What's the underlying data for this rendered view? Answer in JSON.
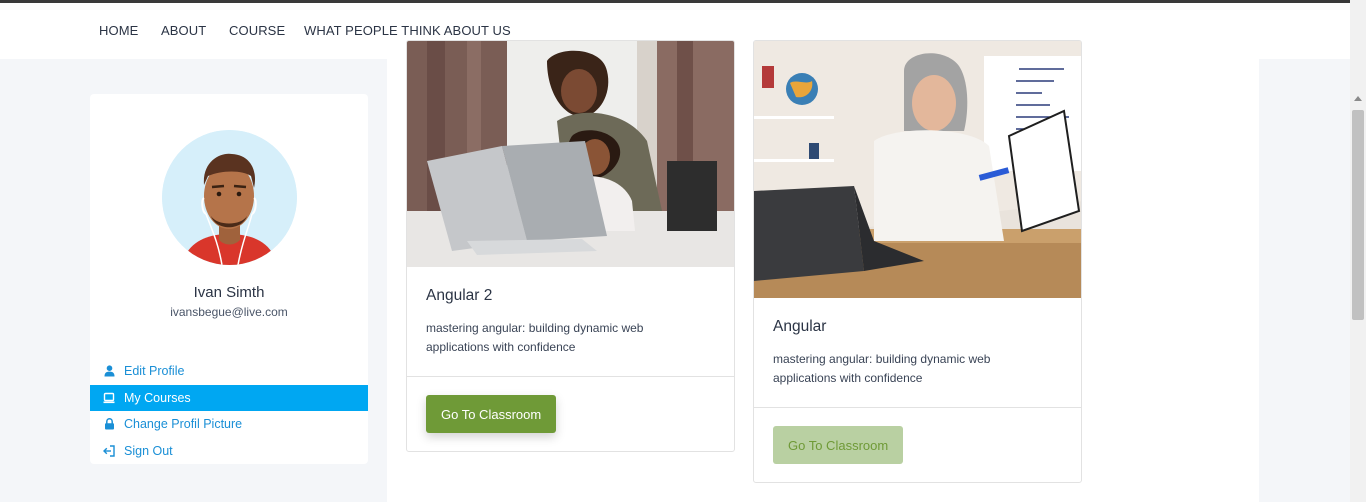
{
  "nav": {
    "items": [
      "HOME",
      "ABOUT",
      "COURSE",
      "WHAT PEOPLE THINK ABOUT US"
    ]
  },
  "profile": {
    "name": "Ivan Simth",
    "email": "ivansbegue@live.com"
  },
  "menu": {
    "items": [
      {
        "label": "Edit Profile",
        "icon": "user-icon"
      },
      {
        "label": "My Courses",
        "icon": "laptop-icon",
        "active": true
      },
      {
        "label": "Change Profil Picture",
        "icon": "lock-icon"
      },
      {
        "label": "Sign Out",
        "icon": "sign-out-icon"
      }
    ]
  },
  "courses": [
    {
      "title": "Angular 2",
      "description": "mastering angular: building dynamic web applications with confidence",
      "button": "Go To Classroom",
      "button_state": "active"
    },
    {
      "title": "Angular",
      "description": "mastering angular: building dynamic web applications with confidence",
      "button": "Go To Classroom",
      "button_state": "disabled"
    }
  ],
  "colors": {
    "accent": "#00a7f2",
    "link": "#1a8fd6",
    "button": "#6f9a37",
    "button_disabled": "#b9d0a2"
  }
}
